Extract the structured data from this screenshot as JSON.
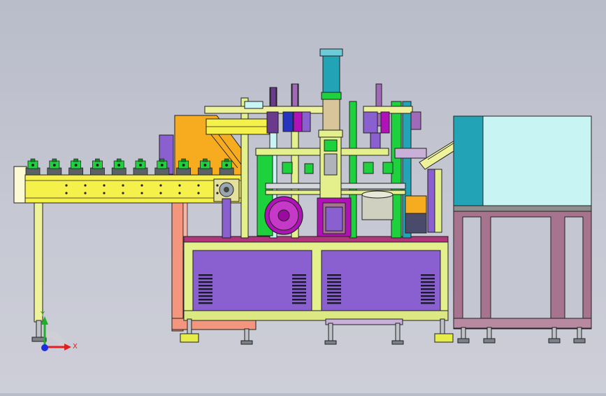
{
  "triad": {
    "x_label": "X",
    "y_label": "Y",
    "x_color": "#e0201c",
    "y_color": "#1fb02a",
    "z_color": "#1a2ee0"
  },
  "colors": {
    "background": "#c4c6d1",
    "conveyor_yellow": "#f5f04a",
    "frame_lime": "#e4f08c",
    "panel_purple": "#8a5fcf",
    "motor_magenta": "#b012b8",
    "orange_guard": "#f7ab1e",
    "salmon_frame": "#f4967e",
    "cyan_housing": "#c9f4f4",
    "teal_column": "#22a4b6",
    "mauve_stand": "#a6748e",
    "green_parts": "#1ed23e"
  }
}
